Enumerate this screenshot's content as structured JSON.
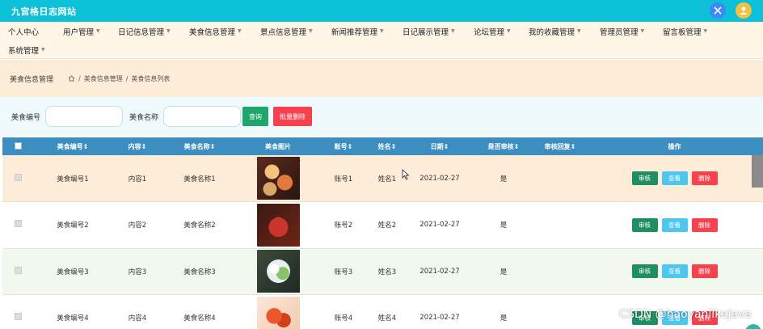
{
  "app": {
    "title": "九宫格日志网站"
  },
  "nav": {
    "row1": [
      "个人中心",
      "用户管理",
      "日记信息管理",
      "美食信息管理",
      "景点信息管理",
      "新闻推荐管理",
      "日记展示管理",
      "论坛管理",
      "我的收藏管理",
      "管理员管理",
      "留言板管理"
    ],
    "row2": [
      "系统管理"
    ]
  },
  "breadcrumb": {
    "title": "美食信息管理",
    "path": [
      "美食信息管理",
      "美食信息列表"
    ],
    "separator": "/"
  },
  "search": {
    "label1": "美食编号",
    "label2": "美食名称",
    "search_btn": "查询",
    "batch_delete_btn": "批量删除"
  },
  "table": {
    "headers": [
      "美食编号",
      "内容",
      "美食名称",
      "美食图片",
      "账号",
      "姓名",
      "日期",
      "是否审核",
      "审核回复",
      "操作"
    ],
    "rows": [
      {
        "code": "美食编号1",
        "content": "内容1",
        "name": "美食名称1",
        "account": "账号1",
        "person": "姓名1",
        "date": "2021-02-27",
        "audited": "是",
        "reply": ""
      },
      {
        "code": "美食编号2",
        "content": "内容2",
        "name": "美食名称2",
        "account": "账号2",
        "person": "姓名2",
        "date": "2021-02-27",
        "audited": "是",
        "reply": ""
      },
      {
        "code": "美食编号3",
        "content": "内容3",
        "name": "美食名称3",
        "account": "账号3",
        "person": "姓名3",
        "date": "2021-02-27",
        "audited": "是",
        "reply": ""
      },
      {
        "code": "美食编号4",
        "content": "内容4",
        "name": "美食名称4",
        "account": "账号4",
        "person": "姓名4",
        "date": "2021-02-27",
        "audited": "是",
        "reply": ""
      }
    ],
    "op_labels": {
      "audit": "审核",
      "view": "查看",
      "delete": "删除"
    }
  },
  "watermark": "CSDN @haoyanlikeJava",
  "colors": {
    "topbar": "#0cc0d8",
    "nav_bg": "#fff6e8",
    "table_header": "#3c8ec1",
    "btn_green": "#1f8f63",
    "btn_blue": "#4dc7ef",
    "btn_red": "#f6424f"
  }
}
